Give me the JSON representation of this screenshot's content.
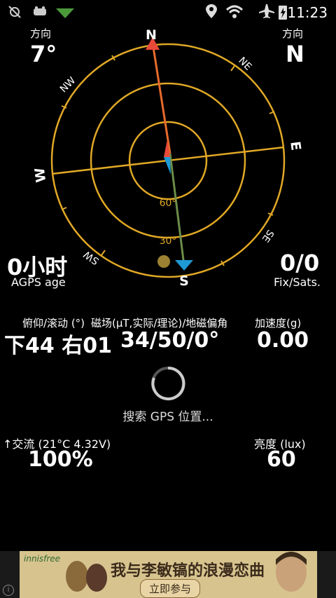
{
  "status_bar": {
    "time": "11:23",
    "icons": [
      "satellite-off-icon",
      "usb-icon",
      "signal-icon",
      "location-icon",
      "wifi-icon",
      "airplane-icon",
      "battery-charging-icon"
    ]
  },
  "colors": {
    "ring": "#e0a826",
    "north_arrow": "#e84a3a",
    "south_arrow": "#1e9ad6",
    "needle_top": "#e86b2d",
    "needle_bottom": "#6b8e49",
    "dot": "#9c8132",
    "tick_divider": "#e0a826"
  },
  "heading": {
    "left_label": "方向",
    "left_value": "7°",
    "right_label": "方向",
    "right_value": "N"
  },
  "compass": {
    "N": "N",
    "NE": "NE",
    "E": "E",
    "SE": "SE",
    "S": "S",
    "SW": "SW",
    "W": "W",
    "NW": "NW",
    "ring_60": "60°",
    "ring_30": "30°"
  },
  "agps": {
    "value": "0小时",
    "label": "AGPS age"
  },
  "fix": {
    "value": "0/0",
    "label": "Fix/Sats."
  },
  "sensors": {
    "orientation_label": "俯仰/滚动 (°)",
    "magnetic_label": "磁场(μT,实际/理论)/地磁偏角",
    "accel_label": "加速度(g)",
    "orientation_value": "下44 右01",
    "magnetic_value": "34/50/0°",
    "accel_value": "0.00"
  },
  "search": {
    "text": "搜索 GPS 位置..."
  },
  "battery": {
    "label": "↑交流 (21°C 4.32V)",
    "value": "100%"
  },
  "light": {
    "label": "亮度 (lux)",
    "value": "60"
  },
  "ad": {
    "brand": "innisfree",
    "headline": "我与李敏镐的浪漫恋曲",
    "button": "立即参与"
  }
}
